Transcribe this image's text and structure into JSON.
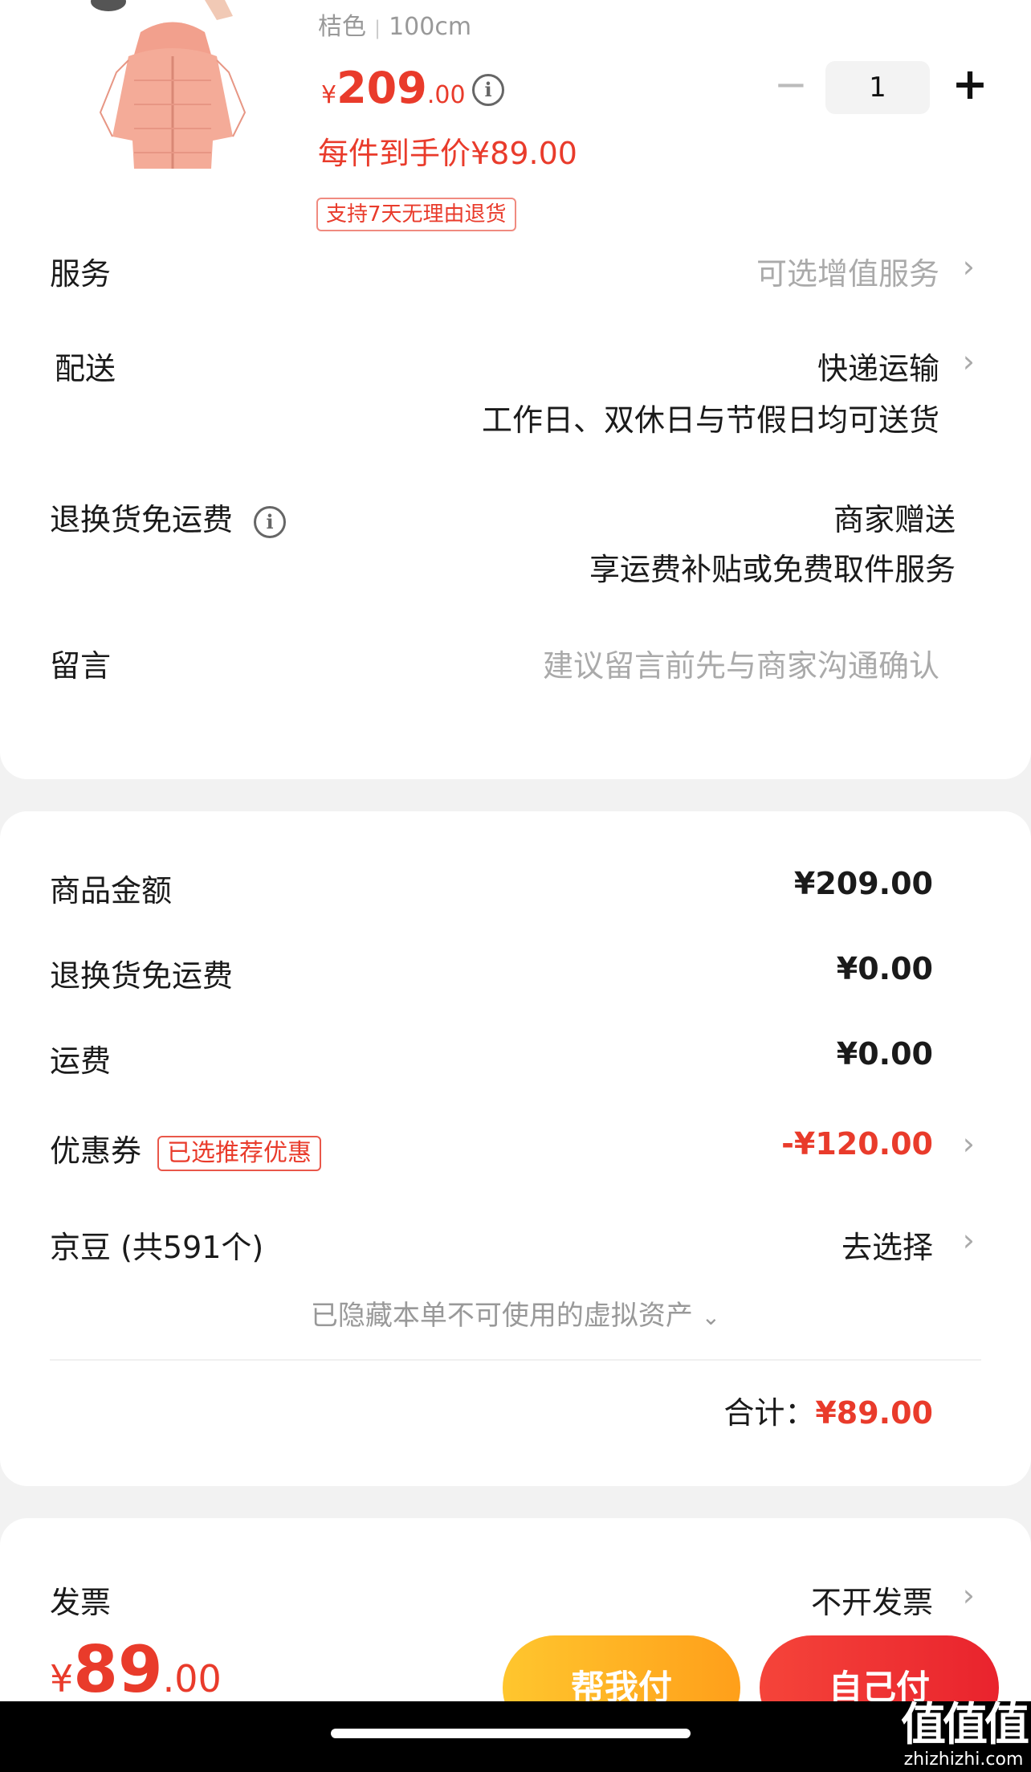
{
  "product": {
    "color": "桔色",
    "size": "100cm",
    "price_yen": "¥",
    "price_int": "209",
    "price_dec": ".00",
    "unit_price": "每件到手价¥89.00",
    "return_badge": "支持7天无理由退货",
    "quantity": "1",
    "minus_label": "−",
    "plus_label": "+"
  },
  "details": {
    "service_label": "服务",
    "service_value": "可选增值服务",
    "delivery_label": "配送",
    "delivery_value": "快递运输",
    "delivery_note": "工作日、双休日与节假日均可送货",
    "return_label": "退换货免运费",
    "return_value": "商家赠送",
    "return_note": "享运费补贴或免费取件服务",
    "message_label": "留言",
    "message_placeholder": "建议留言前先与商家沟通确认"
  },
  "amounts": {
    "goods_label": "商品金额",
    "goods_value": "¥209.00",
    "return_fee_label": "退换货免运费",
    "return_fee_value": "¥0.00",
    "shipping_label": "运费",
    "shipping_value": "¥0.00",
    "coupon_label": "优惠券",
    "coupon_badge": "已选推荐优惠",
    "coupon_value": "-¥120.00",
    "jingdou_label": "京豆 (共591个)",
    "jingdou_value": "去选择",
    "hidden_assets": "已隐藏本单不可使用的虚拟资产",
    "total_label": "合计：",
    "total_value": "¥89.00"
  },
  "invoice": {
    "label": "发票",
    "value": "不开发票"
  },
  "bottom_bar": {
    "price_yen": "¥",
    "price_int": "89",
    "price_dec": ".00",
    "friend_pay": "帮我付",
    "self_pay": "自己付"
  },
  "watermark": {
    "logo": "值值值",
    "url": "zhizhizhi.com"
  },
  "colors": {
    "accent_red": "#e93b2b",
    "friend_button": "#ffb020",
    "self_button": "#ee3030"
  },
  "icons": {
    "info": "info-icon",
    "chevron": "chevron-right-icon",
    "expand": "chevron-down-icon"
  }
}
